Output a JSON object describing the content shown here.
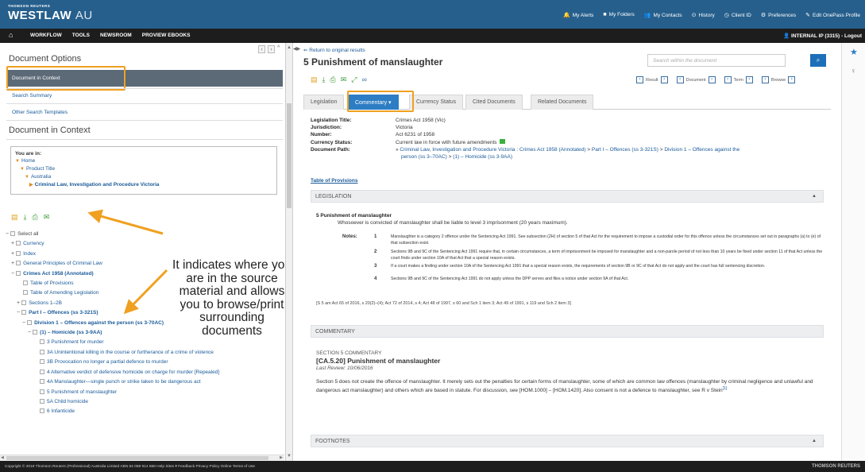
{
  "header": {
    "brand_small": "THOMSON REUTERS",
    "brand": "WESTLAW",
    "brand_region": "AU",
    "links": [
      {
        "icon": "🔔",
        "icon_name": "bell-icon",
        "label": "My Alerts"
      },
      {
        "icon": "■",
        "icon_name": "folder-icon",
        "label": "My Folders"
      },
      {
        "icon": "👥",
        "icon_name": "contacts-icon",
        "label": "My Contacts"
      },
      {
        "icon": "⊙",
        "icon_name": "history-icon",
        "label": "History"
      },
      {
        "icon": "◷",
        "icon_name": "clock-icon",
        "label": "Client ID"
      },
      {
        "icon": "⚙",
        "icon_name": "gear-icon",
        "label": "Preferences"
      },
      {
        "icon": "✎",
        "icon_name": "edit-icon",
        "label": "Edit OnePass Profile"
      }
    ]
  },
  "nav": {
    "home_icon": "⌂",
    "items": [
      "WORKFLOW",
      "TOOLS",
      "NEWSROOM",
      "PROVIEW EBOOKS"
    ],
    "user": "INTERNAL IP (3315) - Logout"
  },
  "sidebar": {
    "title": "Document Options",
    "selected_item": "Document in Context",
    "links": [
      "Search Summary",
      "Other Search Templates"
    ],
    "context_title": "Document in Context",
    "you_are_in_label": "You are in:",
    "breadcrumb": [
      "Home",
      "Product Title",
      "Australia",
      "Criminal Law, Investigation and Procedure Victoria"
    ],
    "tree": [
      {
        "pm": "−",
        "label": "Select all",
        "bold": false,
        "indent": 0,
        "plain": true
      },
      {
        "pm": "+",
        "label": "Currency",
        "bold": false,
        "indent": 1
      },
      {
        "pm": "+",
        "label": "Index",
        "bold": false,
        "indent": 1
      },
      {
        "pm": "+",
        "label": "General Principles of Criminal Law",
        "bold": false,
        "indent": 1
      },
      {
        "pm": "−",
        "label": "Crimes Act 1958 (Annotated)",
        "bold": true,
        "indent": 1
      },
      {
        "pm": "",
        "label": "Table of Provisions",
        "bold": false,
        "indent": 2
      },
      {
        "pm": "",
        "label": "Table of Amending Legislation",
        "bold": false,
        "indent": 2
      },
      {
        "pm": "+",
        "label": "Sections 1–2B",
        "bold": false,
        "indent": 2
      },
      {
        "pm": "−",
        "label": "Part I – Offences (ss 3-321S)",
        "bold": true,
        "indent": 2
      },
      {
        "pm": "−",
        "label": "Division 1 – Offences against the person (ss 3-70AC)",
        "bold": true,
        "indent": 3
      },
      {
        "pm": "−",
        "label": "(1) – Homicide (ss 3-9AA)",
        "bold": true,
        "indent": 4
      },
      {
        "pm": "",
        "label": "3 Punishment for murder",
        "bold": false,
        "indent": 5
      },
      {
        "pm": "",
        "label": "3A Unintentional killing in the course or furtherance of a crime of violence",
        "bold": false,
        "indent": 5
      },
      {
        "pm": "",
        "label": "3B Provocation no longer a partial defence to murder",
        "bold": false,
        "indent": 5
      },
      {
        "pm": "",
        "label": "4 Alternative verdict of defensive homicide on charge for murder [Repealed]",
        "bold": false,
        "indent": 5
      },
      {
        "pm": "",
        "label": "4A Manslaughter—single punch or strike taken to be dangerous act",
        "bold": false,
        "indent": 5
      },
      {
        "pm": "",
        "label": "5 Punishment of manslaughter",
        "bold": false,
        "indent": 5
      },
      {
        "pm": "",
        "label": "5A Child homicide",
        "bold": false,
        "indent": 5
      },
      {
        "pm": "",
        "label": "6 Infanticide",
        "bold": false,
        "indent": 5
      }
    ]
  },
  "annotation": "It indicates where you are in the source material and allows you to browse/print surrounding documents",
  "document": {
    "return_link": "Return to original results",
    "title": "5 Punishment of manslaughter",
    "search_placeholder": "Search within the document",
    "pager": {
      "result": "Result",
      "document": "Document",
      "term": "Term",
      "browse": "Browse"
    },
    "tabs": [
      "Legislation",
      "Commentary ▾",
      "Currency Status",
      "Cited Documents",
      "Related Documents"
    ],
    "active_tab": 1,
    "meta": [
      {
        "k": "Legislation Title:",
        "v": "Crimes Act 1958 (Vic)"
      },
      {
        "k": "Jurisdiction:",
        "v": "Victoria"
      },
      {
        "k": "Number:",
        "v": "Act 6231 of 1958"
      },
      {
        "k": "Currency Status:",
        "v": "Current law in force with future amendments"
      },
      {
        "k": "Document Path:",
        "v": ""
      }
    ],
    "doc_path": [
      "Criminal Law, Investigation and Procedure Victoria",
      "Crimes Act 1958 (Annotated)",
      "Part I – Offences (ss 3-321S)",
      "Division 1 – Offences against the",
      "person (ss 3–70AC)",
      "(1) – Homicide (ss 3-9AA)"
    ],
    "toc_link": "Table of Provisions",
    "legislation_label": "LEGISLATION",
    "section_heading": "5 Punishment of manslaughter",
    "section_text": "Whosoever is convicted of manslaughter shall be liable to level 3 imprisonment (20 years maximum).",
    "notes_label": "Notes:",
    "notes": [
      {
        "n": "1",
        "t": "Manslaughter is a category 2 offence under the Sentencing Act 1991. See subsection (2H) of section 5 of that Act for the requirement to impose a custodial order for this offence unless the circumstances set out in paragraphs (a) to (e) of that subsection exist."
      },
      {
        "n": "2",
        "t": "Sections 9B and 9C of the Sentencing Act 1991 require that, in certain circumstances, a term of imprisonment be imposed for manslaughter and a non-parole period of not less than 10 years be fixed under section 11 of that Act unless the court finds under section 10A of that Act that a special reason exists."
      },
      {
        "n": "3",
        "t": "If a court makes a finding under section 10A of the Sentencing Act 1991 that a special reason exists, the requirements of section 9B or 9C of that Act do not apply and the court has full sentencing discretion."
      },
      {
        "n": "4",
        "t": "Sections 9B and 9C of the Sentencing Act 1991 do not apply unless the DPP serves and files a notice under section 9A of that Act."
      }
    ],
    "amendments": "[S 5 am Act 65 of 2016, s 20(2)–(4); Act 72 of 2014, s 4; Act 48 of 1997, s 60 and Sch 1 item 3; Act 49 of 1991, s 119 and Sch 2 item 3]",
    "commentary_label": "COMMENTARY",
    "commentary_section": "SECTION 5 COMMENTARY",
    "commentary_heading": "[CA.5.20] Punishment of manslaughter",
    "last_review": "Last Review: 10/06/2016",
    "commentary_text": "Section 5 does not create the offence of manslaughter. It merely sets out the penalties for certain forms of manslaughter, some of which are common law offences (manslaughter by criminal negligence and unlawful and dangerous act manslaughter) and others which are based in statute. For discussion, see [HOM.1000] – [HOM.1420]. Also consent is not a defence to manslaughter, see R v Stein",
    "commentary_footnote": "[1]",
    "footnotes_label": "FOOTNOTES"
  },
  "footer": {
    "copyright": "Copyright © 2018 Thomson Reuters (Professional) Australia Limited ABN 64 058 914 668    Help  Sites ▾   Feedback  Privacy Policy  Online Terms of Use",
    "logo": "THOMSON REUTERS"
  },
  "colors": {
    "header_blue": "#265f8c",
    "nav_black": "#1d1d1d",
    "active_tab": "#2d7dc4",
    "highlight_orange": "#f0a020",
    "link_blue": "#1a5a99"
  }
}
